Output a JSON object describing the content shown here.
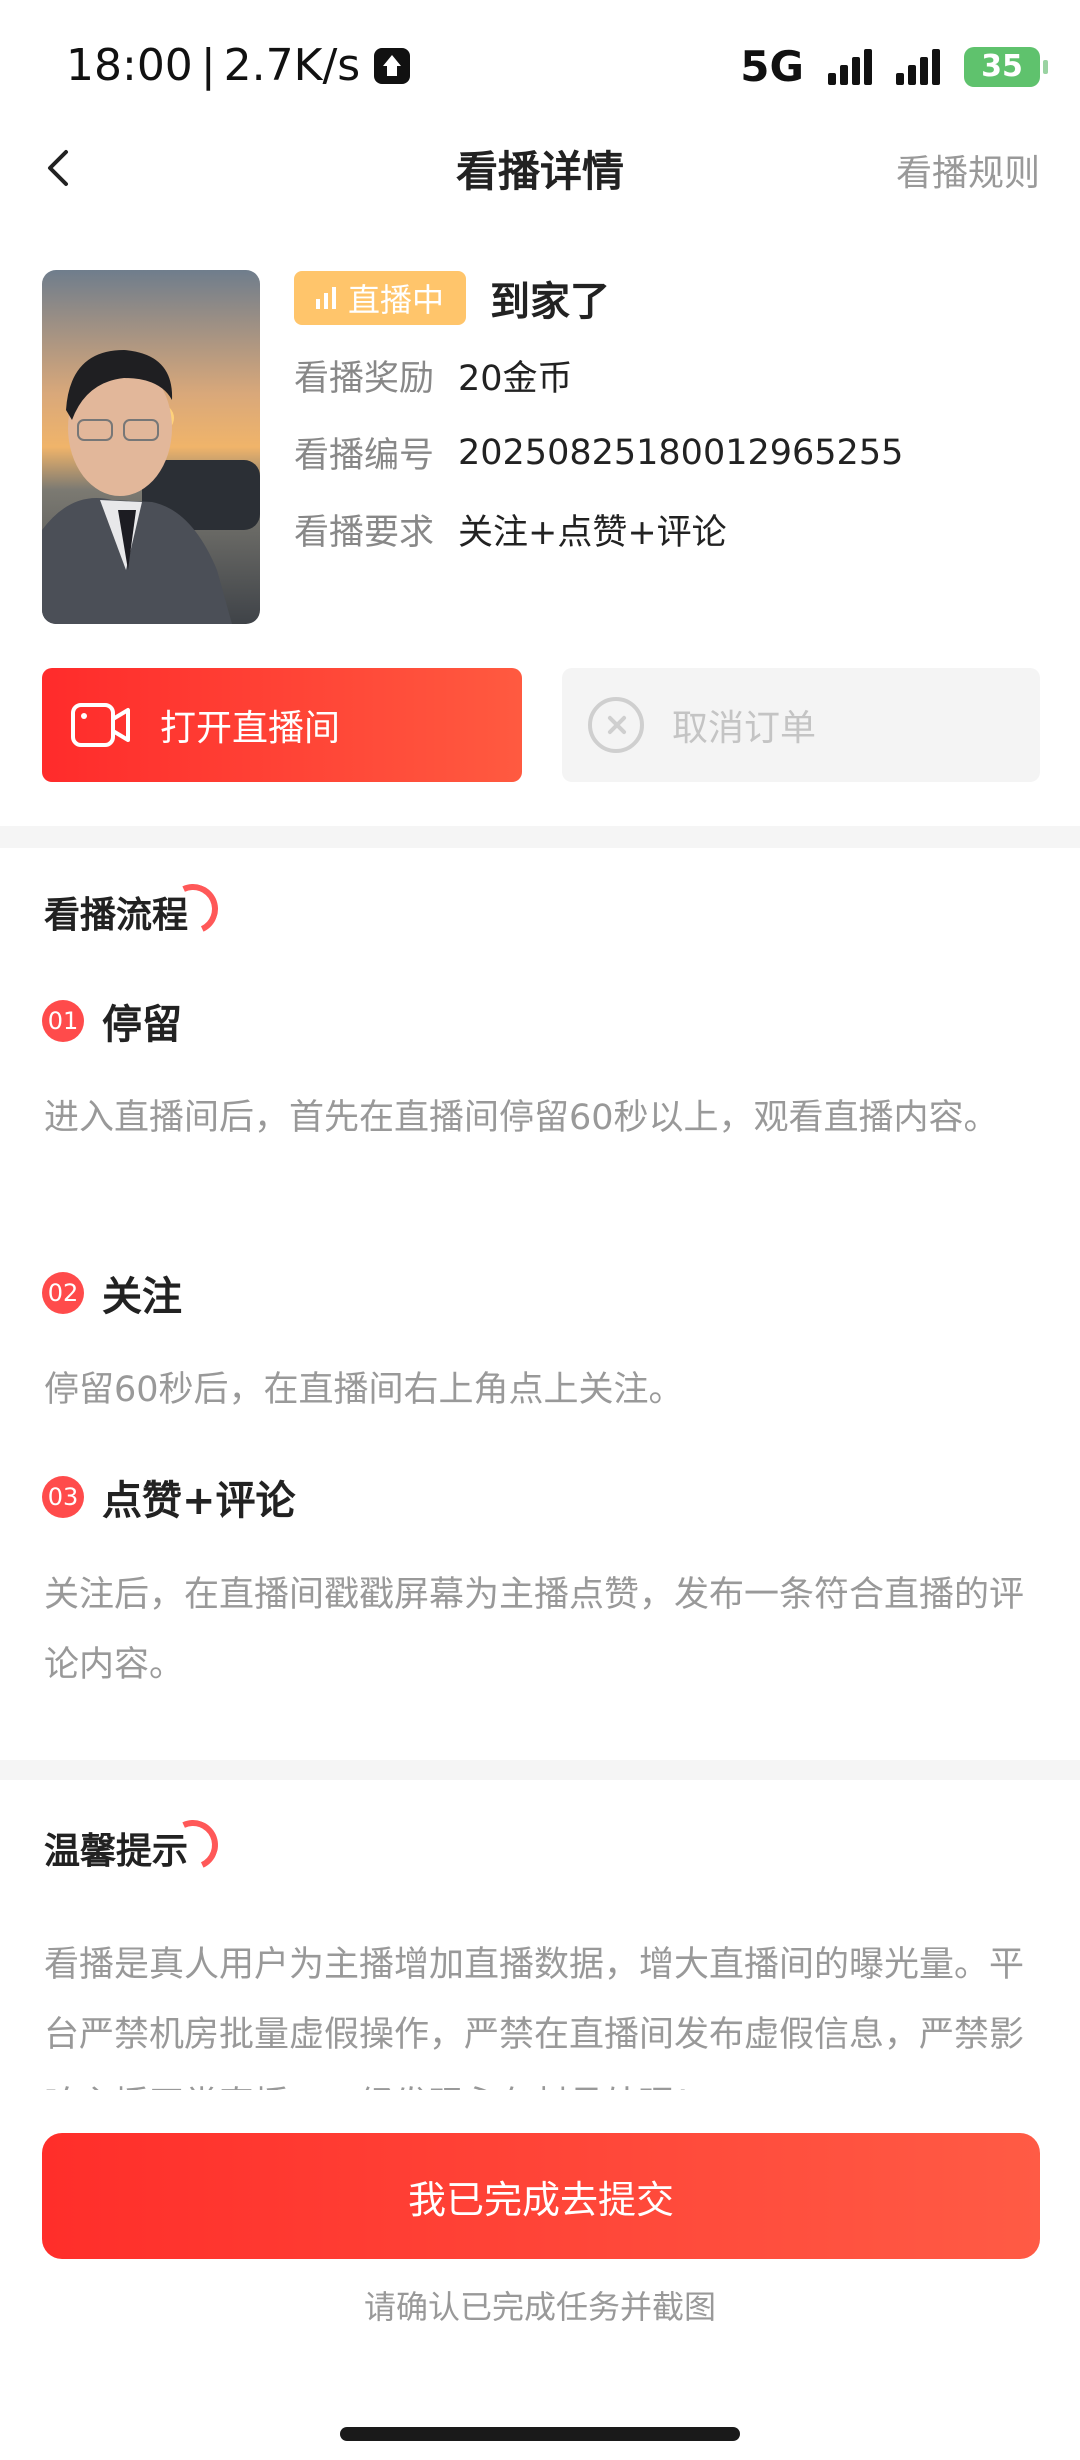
{
  "status_bar": {
    "time": "18:00",
    "speed": "2.7K/s",
    "network": "5G",
    "battery": "35"
  },
  "nav": {
    "title": "看播详情",
    "rules_link": "看播规则"
  },
  "task": {
    "status_badge": "直播中",
    "title": "到家了",
    "fields": [
      {
        "label": "看播奖励",
        "value": "20金币"
      },
      {
        "label": "看播编号",
        "value": "20250825180012965255"
      },
      {
        "label": "看播要求",
        "value": "关注+点赞+评论"
      }
    ],
    "open_button": "打开直播间",
    "cancel_button": "取消订单"
  },
  "process": {
    "title": "看播流程",
    "steps": [
      {
        "num": "01",
        "title": "停留",
        "desc": "进入直播间后，首先在直播间停留60秒以上，观看直播内容。"
      },
      {
        "num": "02",
        "title": "关注",
        "desc": "停留60秒后，在直播间右上角点上关注。"
      },
      {
        "num": "03",
        "title": "点赞+评论",
        "desc": "关注后，在直播间戳戳屏幕为主播点赞，发布一条符合直播的评论内容。"
      }
    ]
  },
  "tips": {
    "title": "温馨提示",
    "text": "看播是真人用户为主播增加直播数据，增大直播间的曝光量。平台严禁机房批量虚假操作，严禁在直播间发布虚假信息，严禁影响主播正常直播，一经发现永久封号处理！"
  },
  "footer": {
    "submit_button": "我已完成去提交",
    "hint": "请确认已完成任务并截图"
  },
  "colors": {
    "accent": "#ff3b30",
    "badge": "#ffc56b",
    "muted": "#999999"
  }
}
